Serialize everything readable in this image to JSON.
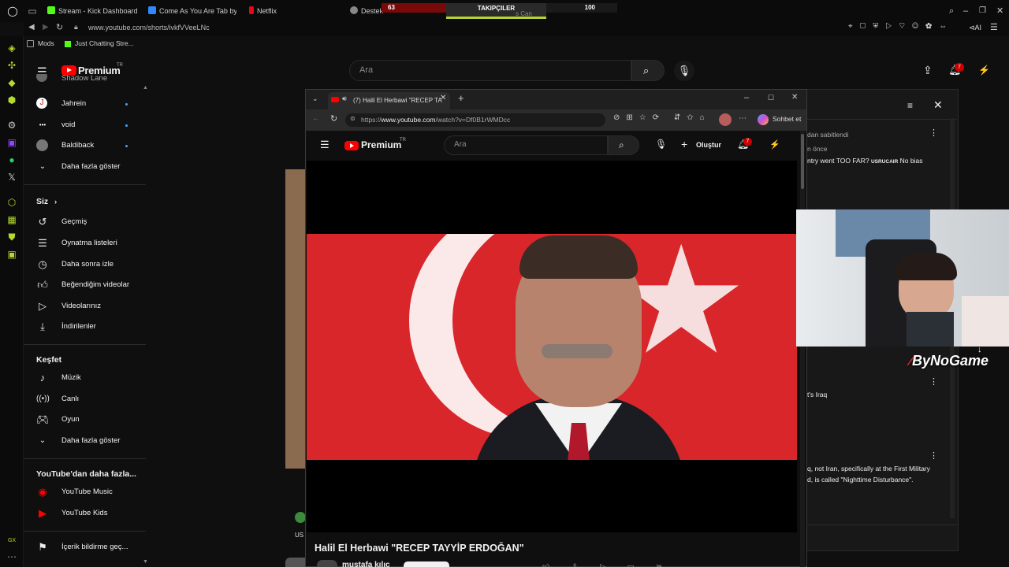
{
  "browser": {
    "tabs": [
      {
        "label": "Stream - Kick Dashboard",
        "color": "#53fc18"
      },
      {
        "label": "Come As You Are Tab by",
        "color": "#2f88ff"
      },
      {
        "label": "Netflix",
        "color": "#e50914"
      },
      {
        "label": "Destek",
        "color": "#888888"
      }
    ],
    "overlay": {
      "left_count": "63",
      "label": "TAKIPÇILER",
      "right_count": "100",
      "hidden_tab": "s Can"
    },
    "url": "www.youtube.com/shorts/ivkfVVeeLNc",
    "bookmarks": [
      "Mods",
      "Just Chatting Stre..."
    ]
  },
  "youtube": {
    "brand": "Premium",
    "region": "TR",
    "search_placeholder": "Ara",
    "notif_count": "7"
  },
  "sidebar": {
    "subscriptions": [
      {
        "label": "Shadow Lane"
      },
      {
        "label": "Jahrein",
        "live": true
      },
      {
        "label": "void",
        "live": true
      },
      {
        "label": "Baldiback",
        "live": true
      }
    ],
    "show_more_1": "Daha fazla göster",
    "you_heading": "Siz",
    "you_items": [
      "Geçmiş",
      "Oynatma listeleri",
      "Daha sonra izle",
      "Beğendiğim videolar",
      "Videolarınız",
      "İndirilenler"
    ],
    "explore_heading": "Keşfet",
    "explore_items": [
      "Müzik",
      "Canlı",
      "Oyun"
    ],
    "show_more_2": "Daha fazla göster",
    "more_heading": "YouTube'dan daha fazla...",
    "more_items": [
      "YouTube Music",
      "YouTube Kids"
    ],
    "report": "İçerik bildirme geç..."
  },
  "popup": {
    "tab_title": "(7) Halil El Herbawi \"RECEP TA",
    "url_prefix": "https://",
    "url_host": "www.youtube.com",
    "url_path": "/watch?v=Df0B1rWMDcc",
    "chat_button": "Sohbet et",
    "brand": "Premium",
    "region": "TR",
    "search_placeholder": "Ara",
    "create": "Oluştur",
    "notif_count": "7",
    "video_title": "Halil El Herbawi \"RECEP TAYYİP ERDOĞAN\"",
    "channel": "mustafa kılıç"
  },
  "right_panel": {
    "pinned": "dan sabitlendi",
    "ago": "n önce",
    "line1": "ntry went TOO FAR?",
    "line1_user": "USRUCAIR",
    "line1_tail": "No bias",
    "line2": "t's Iraq",
    "line3": "q, not Iran, specifically at the First Military",
    "line4": "d, is called \"Nighttime Disturbance\"."
  },
  "webcam": {
    "brand": "ByNoGame"
  },
  "bg_video_label": "US"
}
